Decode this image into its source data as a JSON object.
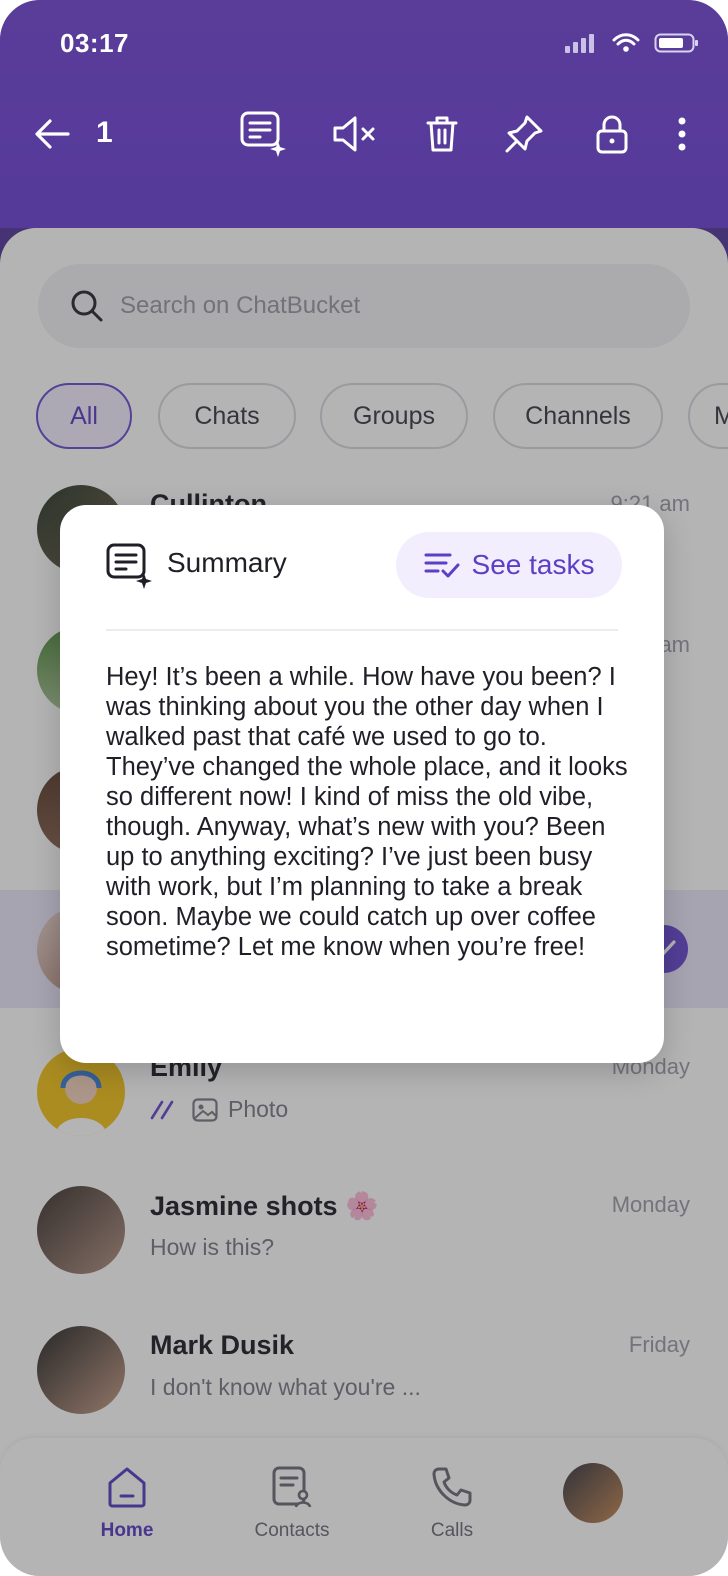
{
  "status": {
    "time": "03:17"
  },
  "action_bar": {
    "selected_count": "1"
  },
  "search": {
    "placeholder": "Search on ChatBucket"
  },
  "tabs": [
    "All",
    "Chats",
    "Groups",
    "Channels",
    "M"
  ],
  "chats": [
    {
      "name": "Cullinton",
      "time": "9:21 am",
      "message": ""
    },
    {
      "name": "",
      "time": "am",
      "message": ""
    },
    {
      "name": "Emily",
      "time": "Monday",
      "message": "Photo"
    },
    {
      "name": "Jasmine shots",
      "emoji": "🌸",
      "time": "Monday",
      "message": "How is this?"
    },
    {
      "name": "Mark Dusik",
      "time": "Friday",
      "message": "I don't know what you're ..."
    }
  ],
  "modal": {
    "title": "Summary",
    "see_tasks": "See tasks",
    "body": "Hey! It’s been a while. How have you been? I was thinking about you the other day when I walked past that café we used to go to. They’ve changed the whole place, and it looks so different now! I kind of miss the old vibe, though. Anyway, what’s new with you? Been up to anything exciting? I’ve just been busy with work, but I’m planning to take a break soon. Maybe we could catch up over coffee sometime? Let me know when you’re free!"
  },
  "nav": {
    "home": "Home",
    "contacts": "Contacts",
    "calls": "Calls"
  },
  "colors": {
    "brand": "#5a3d99",
    "accent": "#5b3fc4",
    "accent_bg": "#f2eefe"
  },
  "icons": [
    "back-arrow-icon",
    "ai-summary-icon",
    "mute-icon",
    "trash-icon",
    "pin-icon",
    "lock-icon",
    "more-vertical-icon",
    "search-icon",
    "double-check-icon",
    "image-icon",
    "home-icon",
    "contacts-icon",
    "phone-icon",
    "checkmark-icon"
  ]
}
